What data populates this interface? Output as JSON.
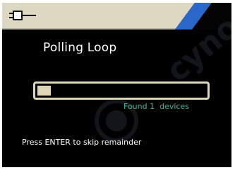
{
  "screen": {
    "title": "Polling Loop",
    "status": "Found 1  devices",
    "hint": "Press ENTER to skip remainder",
    "progress": 0.08
  },
  "header": {
    "icon": "plug-icon"
  },
  "watermark": {
    "text": "cyno"
  },
  "colors": {
    "background": "#000000",
    "header": "#ddd8c2",
    "accent": "#2a67c8",
    "status_text": "#45b69c",
    "progress_bar": "#ddd7b8"
  }
}
